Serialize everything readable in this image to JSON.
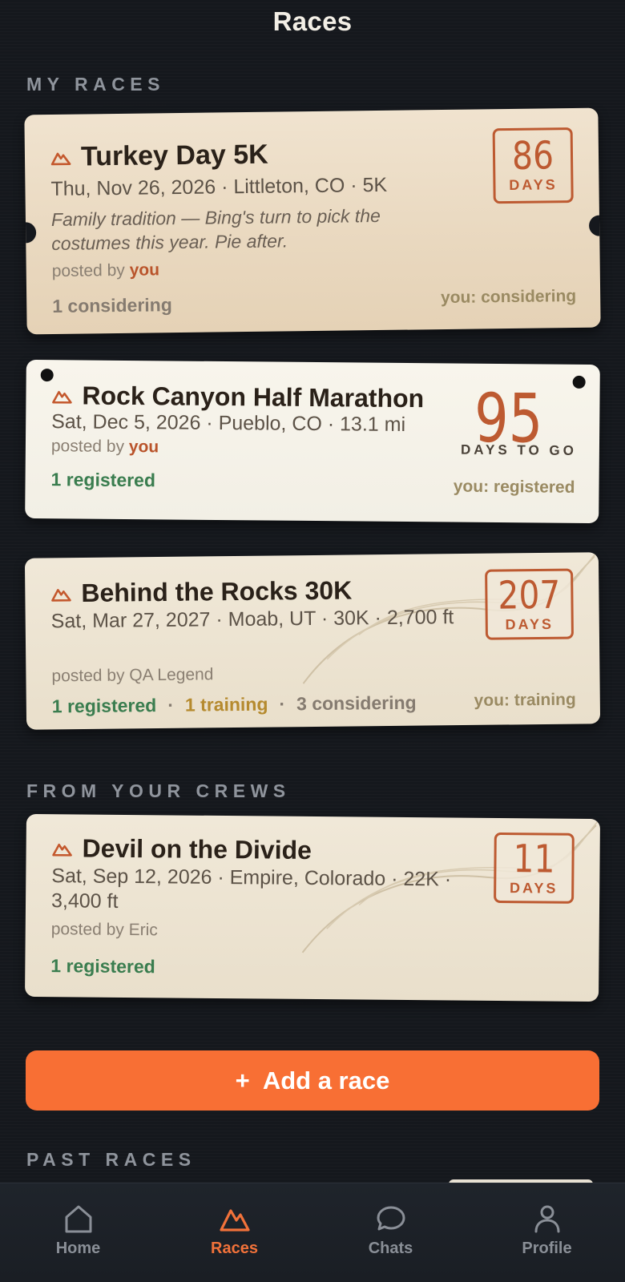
{
  "header": {
    "title": "Races"
  },
  "sections": {
    "my_races": "MY RACES",
    "from_crews": "FROM YOUR CREWS",
    "past_races": "PAST RACES"
  },
  "races": [
    {
      "title": "Turkey Day 5K",
      "meta": "Thu, Nov 26, 2026 · Littleton, CO · 5K",
      "note": "Family tradition — Bing's turn to pick the costumes this year. Pie after.",
      "posted_prefix": "posted by ",
      "posted_by": "you",
      "statuses": [
        "1 considering"
      ],
      "you_status": "you: considering",
      "days": "86",
      "days_label": "DAYS"
    },
    {
      "title": "Rock Canyon Half Marathon",
      "meta": "Sat, Dec 5, 2026 · Pueblo, CO · 13.1 mi",
      "posted_prefix": "posted by ",
      "posted_by": "you",
      "statuses": [
        "1 registered"
      ],
      "you_status": "you: registered",
      "days": "95",
      "days_label": "DAYS TO GO"
    },
    {
      "title": "Behind the Rocks 30K",
      "meta": "Sat, Mar 27, 2027 · Moab, UT · 30K · 2,700 ft",
      "posted": "posted by QA Legend",
      "statuses": [
        "1 registered",
        "1 training",
        "3 considering"
      ],
      "separator": "·",
      "you_status": "you: training",
      "days": "207",
      "days_label": "DAYS"
    },
    {
      "title": "Devil on the Divide",
      "meta": "Sat, Sep 12, 2026 · Empire, Colorado · 22K · 3,400 ft",
      "posted": "posted by Eric",
      "statuses": [
        "1 registered"
      ],
      "days": "11",
      "days_label": "DAYS"
    }
  ],
  "add_button": {
    "icon": "+",
    "label": "Add a race"
  },
  "tabs": [
    {
      "label": "Home",
      "icon": "home-icon"
    },
    {
      "label": "Races",
      "icon": "mountain-icon",
      "active": true
    },
    {
      "label": "Chats",
      "icon": "chat-bubble-icon"
    },
    {
      "label": "Profile",
      "icon": "person-icon"
    }
  ],
  "colors": {
    "accent": "#f86f34",
    "rust": "#bd5a31",
    "green": "#3a7d4f",
    "gold": "#b58a2e"
  }
}
